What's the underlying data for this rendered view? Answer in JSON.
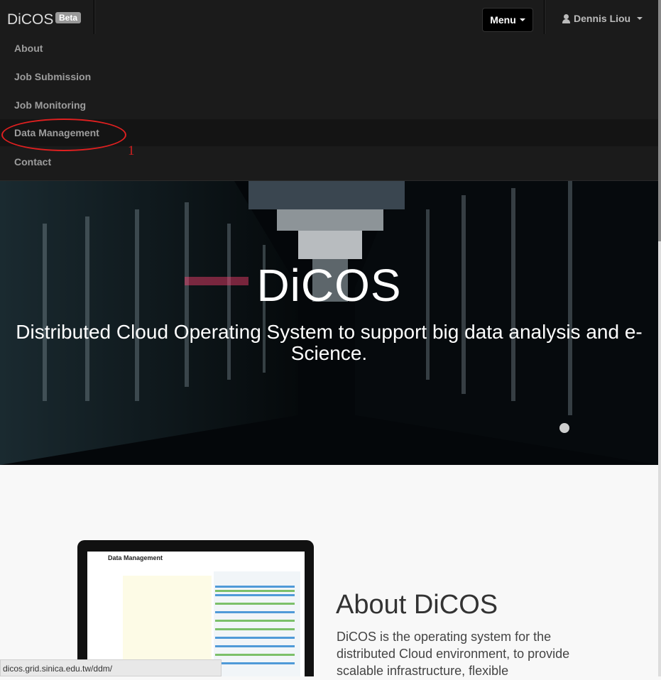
{
  "navbar": {
    "brand": "DiCOS",
    "badge": "Beta",
    "menu_label": "Menu",
    "user_name": "Dennis Liou",
    "items": [
      {
        "label": "About"
      },
      {
        "label": "Job Submission"
      },
      {
        "label": "Job Monitoring"
      },
      {
        "label": "Data Management"
      },
      {
        "label": "Contact"
      }
    ]
  },
  "annotation": {
    "number": "1",
    "color": "#e02020"
  },
  "hero": {
    "title": "DiCOS",
    "subtitle": "Distributed Cloud Operating System to support big data analysis and e-Science."
  },
  "about": {
    "screenshot_title": "Data Management",
    "title": "About DiCOS",
    "text": "DiCOS is the operating system for the distributed Cloud environment, to provide scalable infrastructure, flexible"
  },
  "status_bar": {
    "url": "dicos.grid.sinica.edu.tw/ddm/"
  }
}
